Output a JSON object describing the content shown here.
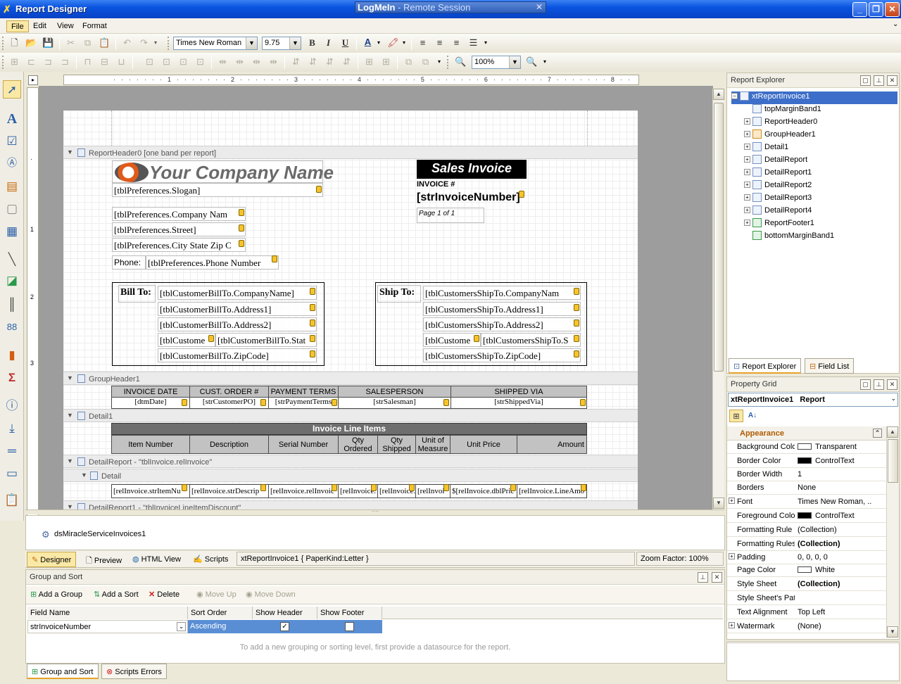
{
  "window": {
    "title": "Report Designer",
    "remote_banner_1": "LogMeIn",
    "remote_banner_2": " - Remote Session"
  },
  "menu": [
    "File",
    "Edit",
    "View",
    "Format"
  ],
  "toolbar": {
    "font_name": "Times New Roman",
    "font_size": "9.75",
    "zoom": "100%",
    "bold": "B",
    "italic": "I",
    "underline": "U",
    "forecolor": "A"
  },
  "report": {
    "report_header_band": "ReportHeader0 [one band per report]",
    "logo_text": "Your Company Name",
    "slogan": "[tblPreferences.Slogan]",
    "company_name": "[tblPreferences.Company Nam",
    "street": "[tblPreferences.Street]",
    "city_state_zip": "[tblPreferences.City State Zip C",
    "phone_label": "Phone:",
    "phone": "[tblPreferences.Phone Number",
    "sales_invoice": "Sales Invoice",
    "invoice_label": "INVOICE #",
    "invoice_number": "[strInvoiceNumber]",
    "page_of": "Page 1 of 1",
    "bill_to_label": "Bill To:",
    "bill_to": [
      "[tblCustomerBillTo.CompanyName]",
      "[tblCustomerBillTo.Address1]",
      "[tblCustomerBillTo.Address2]",
      "[tblCustome",
      "[tblCustomerBillTo.Stat",
      "[tblCustomerBillTo.ZipCode]"
    ],
    "ship_to_label": "Ship To:",
    "ship_to": [
      "[tblCustomersShipTo.CompanyNam",
      "[tblCustomersShipTo.Address1]",
      "[tblCustomersShipTo.Address2]",
      "[tblCustome",
      "[tblCustomersShipTo.S",
      "[tblCustomersShipTo.ZipCode]"
    ],
    "group_header_band": "GroupHeader1",
    "group_cols": [
      "INVOICE DATE",
      "CUST. ORDER #",
      "PAYMENT TERMS",
      "SALESPERSON",
      "SHIPPED VIA"
    ],
    "group_vals": [
      "[dtmDate]",
      "[strCustomerPO]",
      "[strPaymentTerms",
      "[strSalesman]",
      "[strShippedVia]"
    ],
    "detail_band": "Detail1",
    "line_items_title": "Invoice Line Items",
    "line_cols": [
      "Item Number",
      "Description",
      "Serial Number",
      "Qty Ordered",
      "Qty Shipped",
      "Unit of Measure",
      "Unit Price",
      "Amount"
    ],
    "detail_report_band": "DetailReport - \"tblInvoice.relInvoice\"",
    "detail_sub_band": "Detail",
    "detail_vals": [
      "[relInvoice.strItemNu",
      "[relInvoice.strDescrip",
      "[relInvoice.relInvoic",
      "[relInvoice.",
      "[relInvoice.",
      "[relInvoi",
      "$[relInvoice.dblPric",
      "[relInvoice.LineAmo"
    ],
    "detail_report1_band": "DetailReport1 - \"tblInvoiceLineItemDiscount\""
  },
  "component_tray": {
    "item": "dsMiracleServiceInvoices1"
  },
  "view_tabs": [
    "Designer",
    "Preview",
    "HTML View",
    "Scripts"
  ],
  "status": {
    "report": "xtReportInvoice1 { PaperKind:Letter }",
    "zoom": "Zoom Factor: 100%"
  },
  "group_sort": {
    "title": "Group and Sort",
    "actions": [
      "Add a Group",
      "Add a Sort",
      "Delete",
      "Move Up",
      "Move Down"
    ],
    "columns": [
      "Field Name",
      "Sort Order",
      "Show Header",
      "Show Footer"
    ],
    "row": {
      "field": "strInvoiceNumber",
      "sort": "Ascending"
    },
    "hint": "To add a new grouping or sorting level, first provide a datasource for the report."
  },
  "bottom_tabs": [
    "Group and Sort",
    "Scripts Errors"
  ],
  "report_explorer": {
    "title": "Report Explorer",
    "root": "xtReportInvoice1",
    "nodes": [
      "topMarginBand1",
      "ReportHeader0",
      "GroupHeader1",
      "Detail1",
      "DetailReport",
      "DetailReport1",
      "DetailReport2",
      "DetailReport3",
      "DetailReport4",
      "ReportFooter1",
      "bottomMarginBand1"
    ],
    "tabs": [
      "Report Explorer",
      "Field List"
    ]
  },
  "property_grid": {
    "title": "Property Grid",
    "object_name": "xtReportInvoice1",
    "object_type": "Report",
    "category": "Appearance",
    "rows": [
      {
        "name": "Background Colo",
        "value": "Transparent",
        "swatch": "#ffffff"
      },
      {
        "name": "Border Color",
        "value": "ControlText",
        "swatch": "#000000"
      },
      {
        "name": "Border Width",
        "value": "1"
      },
      {
        "name": "Borders",
        "value": "None"
      },
      {
        "name": "Font",
        "value": "Times New Roman, ...",
        "expand": true
      },
      {
        "name": "Foreground Colo",
        "value": "ControlText",
        "swatch": "#000000"
      },
      {
        "name": "Formatting Rule",
        "value": "(Collection)"
      },
      {
        "name": "Formatting Rules",
        "value": "(Collection)",
        "bold": true
      },
      {
        "name": "Padding",
        "value": "0, 0, 0, 0",
        "expand": true
      },
      {
        "name": "Page Color",
        "value": "White",
        "swatch": "#ffffff"
      },
      {
        "name": "Style Sheet",
        "value": "(Collection)",
        "bold": true
      },
      {
        "name": "Style Sheet's Pat",
        "value": ""
      },
      {
        "name": "Text Alignment",
        "value": "Top Left"
      },
      {
        "name": "Watermark",
        "value": "(None)",
        "expand": true
      }
    ]
  }
}
